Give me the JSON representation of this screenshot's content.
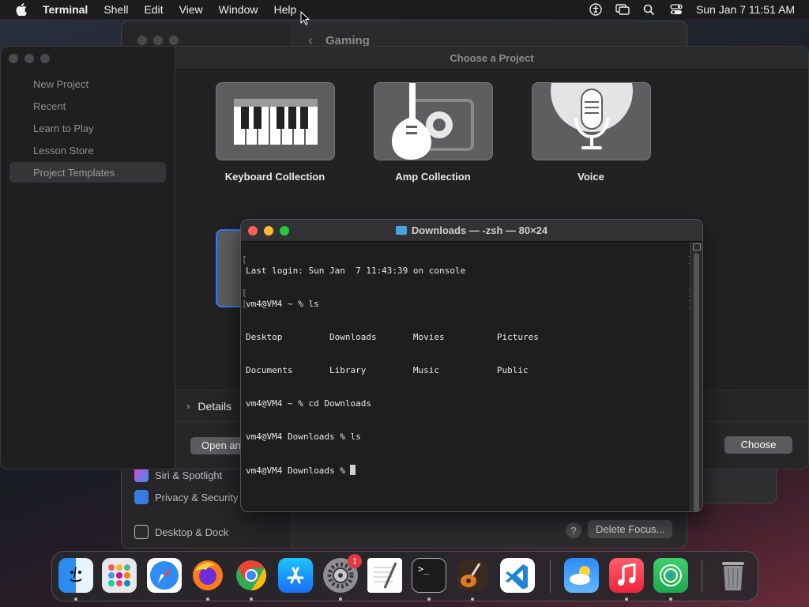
{
  "menubar": {
    "app": "Terminal",
    "items": [
      "Shell",
      "Edit",
      "View",
      "Window",
      "Help"
    ],
    "clock": "Sun Jan 7  11:51 AM"
  },
  "settings": {
    "header": "Gaming",
    "sidebar": [
      "Siri & Spotlight",
      "Privacy & Security",
      "Desktop & Dock"
    ],
    "delete_button": "Delete Focus...",
    "help": "?"
  },
  "garageband": {
    "title": "Choose a Project",
    "nav": [
      "New Project",
      "Recent",
      "Learn to Play",
      "Lesson Store",
      "Project Templates"
    ],
    "tiles": [
      "Keyboard Collection",
      "Amp Collection",
      "Voice"
    ],
    "details": "Details",
    "open_button": "Open an",
    "choose_button": "Choose"
  },
  "terminal": {
    "title": "Downloads — -zsh — 80×24",
    "lines": [
      "Last login: Sun Jan  7 11:43:39 on console",
      "vm4@VM4 ~ % ls",
      "Desktop         Downloads       Movies          Pictures",
      "Documents       Library         Music           Public",
      "vm4@VM4 ~ % cd Downloads",
      "vm4@VM4 Downloads % ls",
      "vm4@VM4 Downloads % "
    ]
  },
  "dock": {
    "apps": [
      "finder-icon",
      "launchpad-icon",
      "safari-icon",
      "firefox-icon",
      "chrome-icon",
      "app-store-icon",
      "system-settings-icon",
      "textedit-icon",
      "terminal-icon",
      "garageband-icon",
      "vscode-icon",
      "weather-icon",
      "music-icon",
      "find-my-icon",
      "trash-icon"
    ],
    "settings_badge": "1"
  }
}
